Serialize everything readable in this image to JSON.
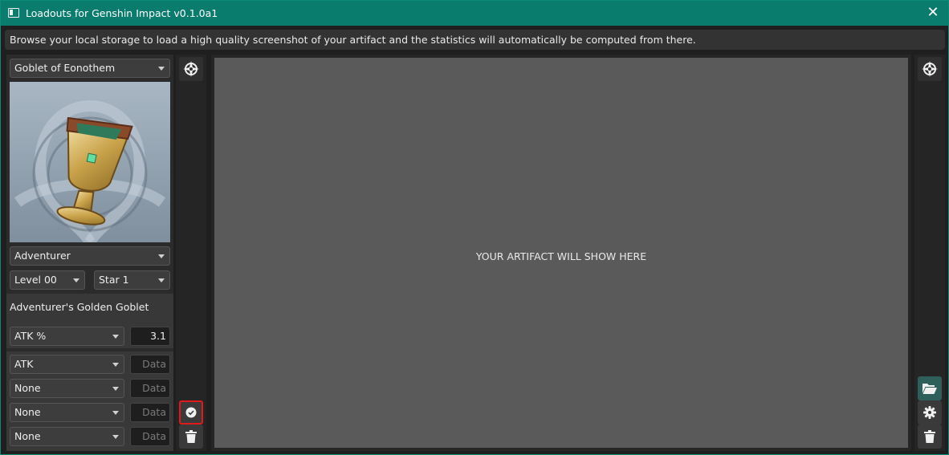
{
  "window": {
    "title": "Loadouts for Genshin Impact v0.1.0a1",
    "close_glyph": "✕"
  },
  "info": {
    "text": "Browse your local storage to load a high quality screenshot of your artifact and the statistics will automatically be computed from there."
  },
  "left": {
    "type_select": "Goblet of Eonothem",
    "set_select": "Adventurer",
    "level_select": "Level 00",
    "rarity_select": "Star 1",
    "artifact_name": "Adventurer's Golden Goblet",
    "main_stat": {
      "stat": "ATK %",
      "value": "3.1"
    },
    "substats": [
      {
        "stat": "ATK",
        "placeholder": "Data"
      },
      {
        "stat": "None",
        "placeholder": "Data"
      },
      {
        "stat": "None",
        "placeholder": "Data"
      },
      {
        "stat": "None",
        "placeholder": "Data"
      }
    ]
  },
  "canvas": {
    "placeholder": "YOUR ARTIFACT WILL SHOW HERE"
  },
  "icons": {
    "compass_left": "compass-icon",
    "confirm": "check-circle-icon",
    "delete_left": "trash-icon",
    "compass_right": "compass-icon",
    "open": "folder-open-icon",
    "settings": "gear-icon",
    "delete_right": "trash-icon"
  },
  "colors": {
    "titlebar": "#0a7c6e",
    "highlight": "#e01a1a"
  }
}
